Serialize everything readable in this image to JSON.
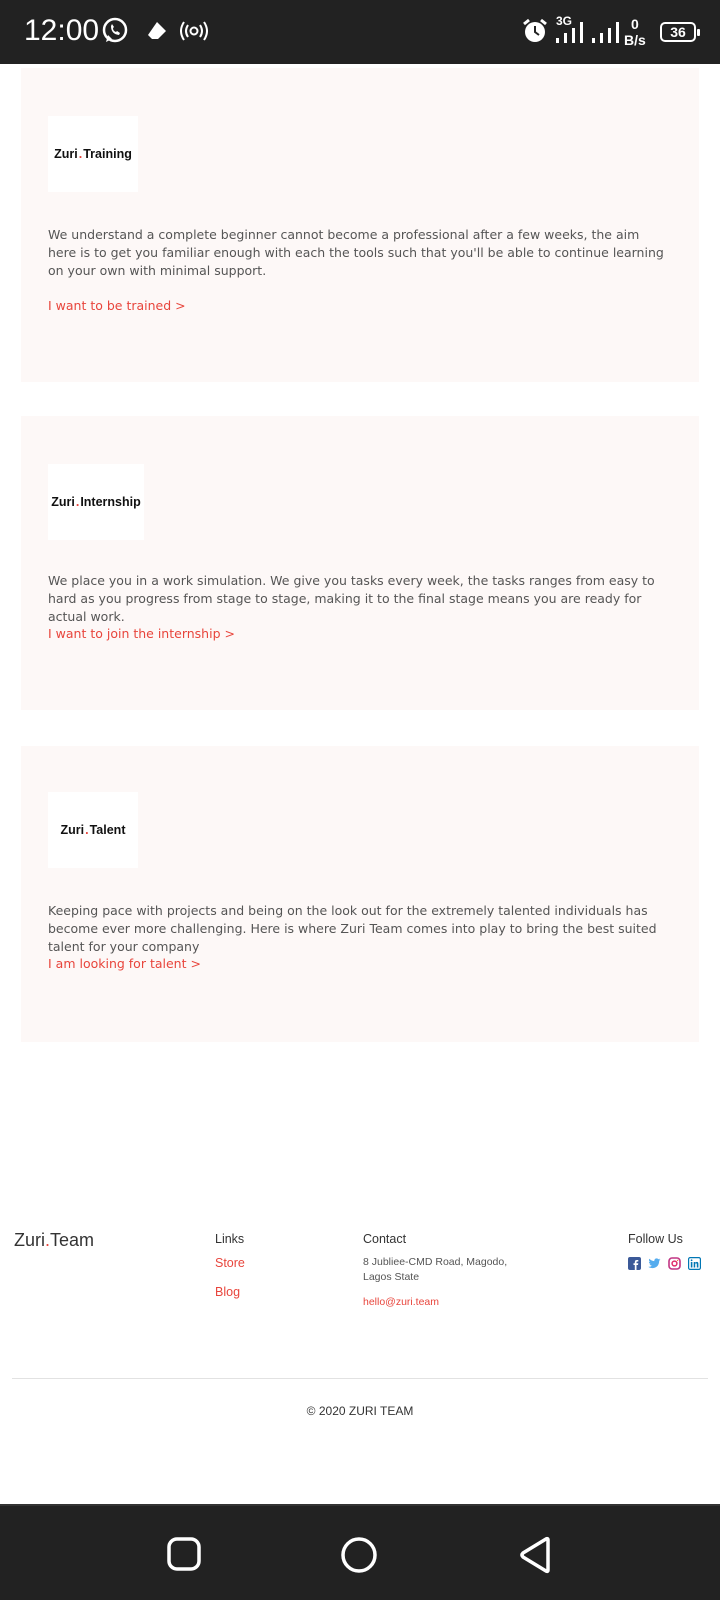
{
  "status_bar": {
    "time": "12:00",
    "network": "3G",
    "speed_value": "0",
    "speed_unit": "B/s",
    "battery": "36"
  },
  "cards": [
    {
      "logo_prefix": "Zuri",
      "logo_dot": ".",
      "logo_suffix": "Training",
      "description": "We understand a complete beginner cannot become a professional after a few weeks, the aim here is to get you familiar enough with each the tools such that you'll be able to continue learning on your own with minimal support.",
      "link": "I want to be trained >"
    },
    {
      "logo_prefix": "Zuri",
      "logo_dot": ".",
      "logo_suffix": "Internship",
      "description": "We place you in a work simulation. We give you tasks every week, the tasks ranges from easy to hard as you progress from stage to stage, making it to the final stage means you are ready for actual work.",
      "link": "I want to join the internship >"
    },
    {
      "logo_prefix": "Zuri",
      "logo_dot": ".",
      "logo_suffix": "Talent",
      "description": "Keeping pace with projects and being on the look out for the extremely talented individuals has become ever more challenging. Here is where Zuri Team comes into play to bring the best suited talent for your company",
      "link": "I am looking for talent >"
    }
  ],
  "footer": {
    "logo_prefix": "Zuri",
    "logo_dot": ".",
    "logo_suffix": "Team",
    "links_title": "Links",
    "links": [
      "Store",
      "Blog"
    ],
    "contact_title": "Contact",
    "address": "8 Jubliee-CMD Road, Magodo, Lagos State",
    "email": "hello@zuri.team",
    "follow_title": "Follow Us",
    "social_icons": [
      "facebook-icon",
      "twitter-icon",
      "instagram-icon",
      "linkedin-icon"
    ],
    "copyright": "© 2020 ZURI TEAM"
  },
  "colors": {
    "accent": "#e8453c",
    "card_bg": "#fdf8f7",
    "system_bar": "#222222"
  }
}
